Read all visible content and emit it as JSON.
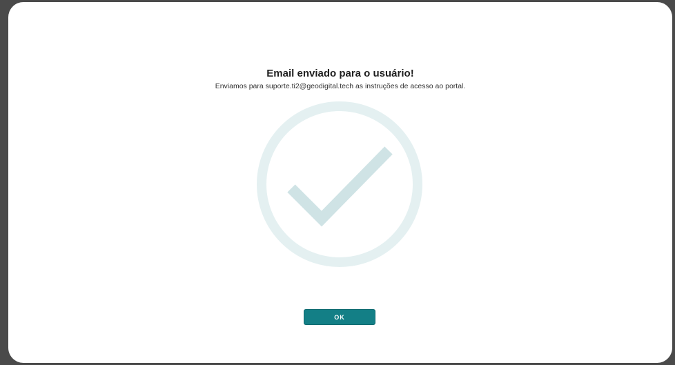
{
  "dialog": {
    "title": "Email enviado para o usuário!",
    "message": "Enviamos para suporte.ti2@geodigital.tech as instruções de acesso ao portal.",
    "icon": "check-circle-icon",
    "ok_label": "OK"
  },
  "colors": {
    "backdrop": "#4a4a4a",
    "check_ring": "#e4f0f1",
    "check_mark": "#cfe3e5",
    "button": "#137f86"
  }
}
